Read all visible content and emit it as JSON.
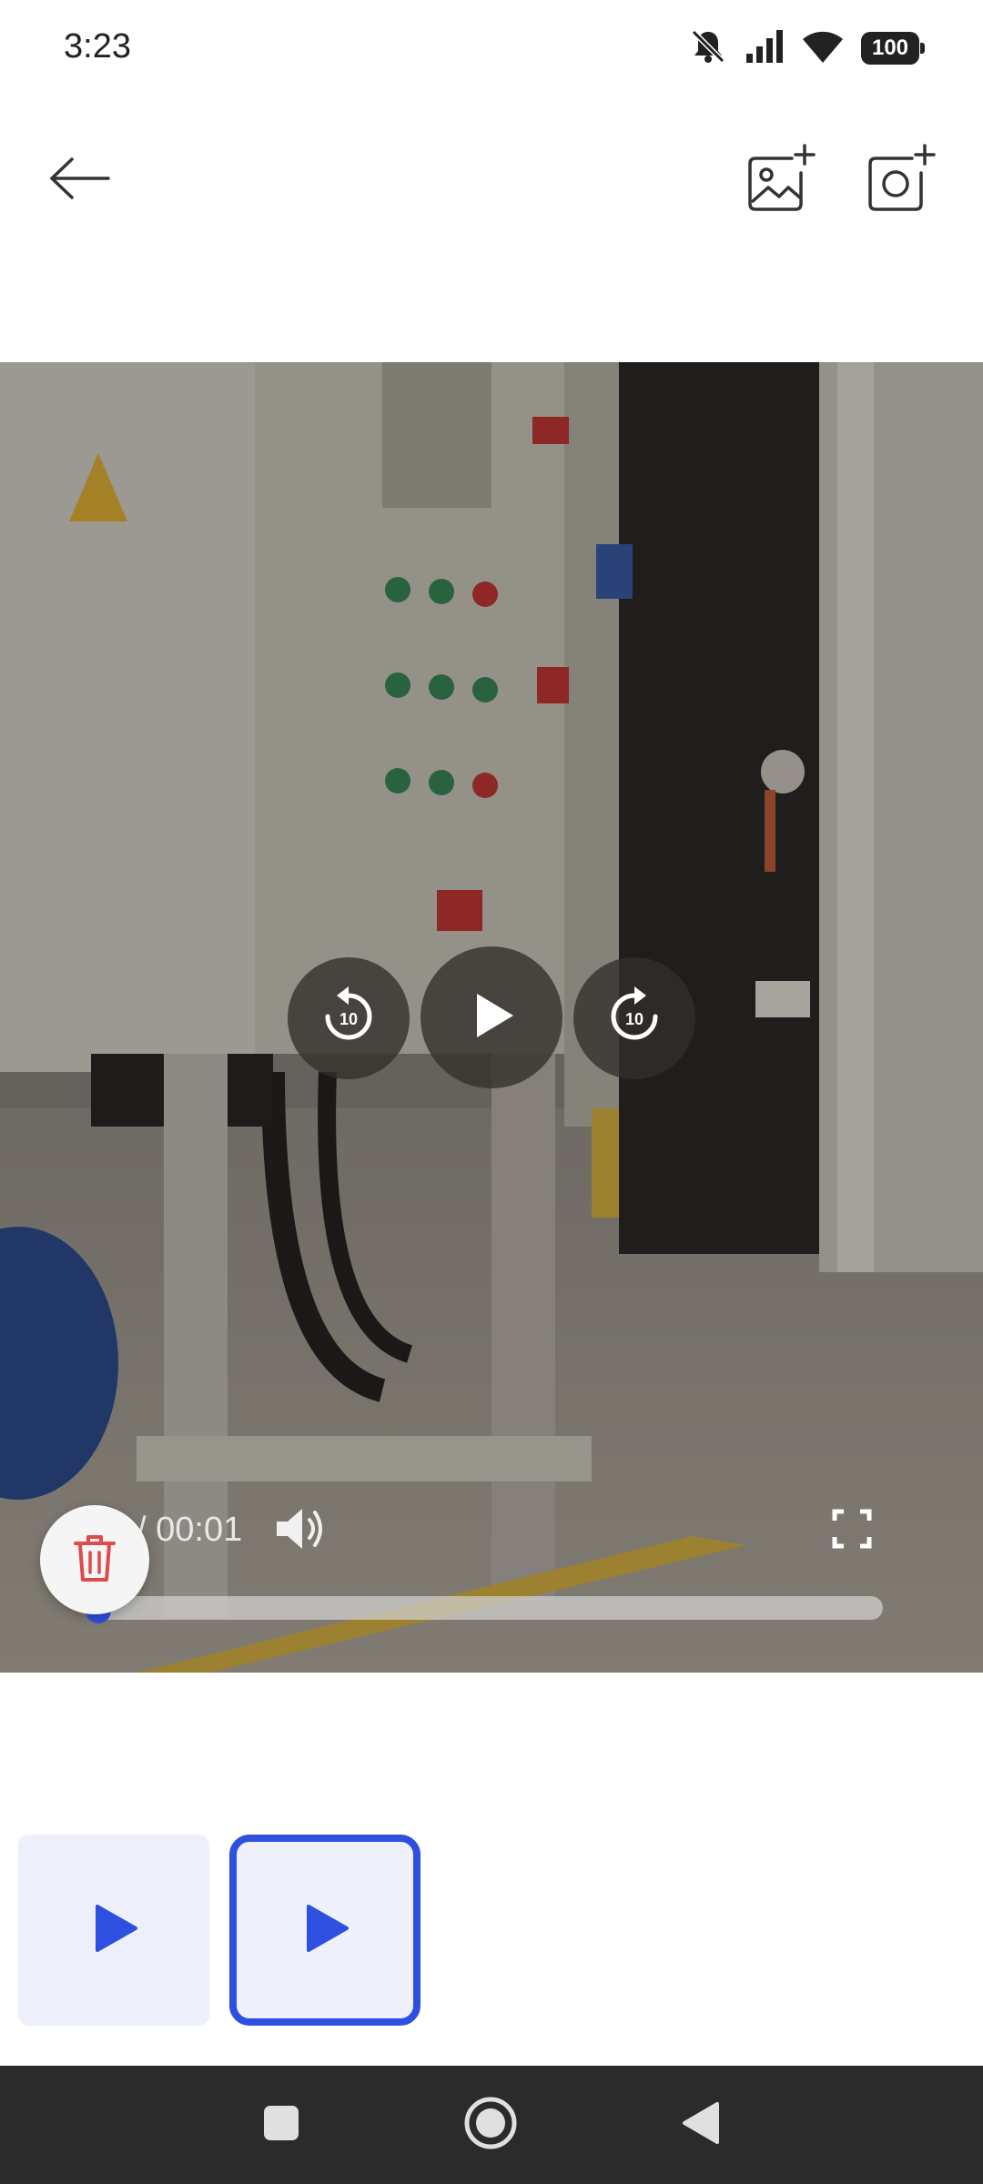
{
  "status_bar": {
    "time": "3:23",
    "battery": "100",
    "icons": [
      "mute-icon",
      "signal-icon",
      "wifi-icon",
      "battery-icon"
    ]
  },
  "toolbar": {
    "back_icon": "arrow-left-icon",
    "add_image_icon": "add-image-icon",
    "add_camera_icon": "add-camera-icon"
  },
  "player": {
    "time": "/ 00:01",
    "rewind_label": "10",
    "forward_label": "10",
    "progress": 0.0
  },
  "thumbnails": [
    {
      "icon": "play-icon",
      "selected": false
    },
    {
      "icon": "play-icon",
      "selected": true
    }
  ],
  "colors": {
    "accent": "#2f4fe0",
    "delete": "#e04a4a",
    "nav_bar": "#2b2b2b"
  }
}
